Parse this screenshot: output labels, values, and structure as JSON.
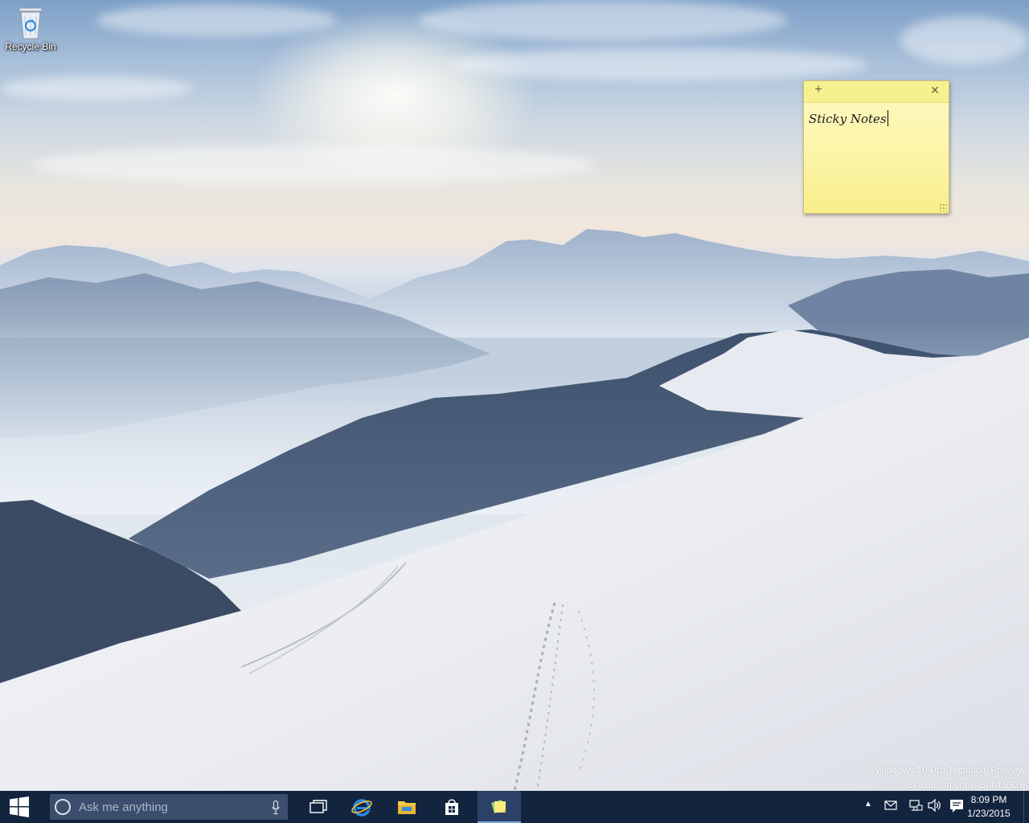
{
  "desktop": {
    "icons": [
      {
        "label": "Recycle Bin",
        "icon": "recycle-bin-icon"
      }
    ],
    "watermark": {
      "line1": "Windows 10 Pro Technical Preview",
      "line2": "Evaluation copy. Build 9926"
    }
  },
  "sticky_note": {
    "text": "Sticky Notes",
    "add_icon": "plus-icon",
    "close_icon": "close-icon",
    "color": "#fcf5a8"
  },
  "taskbar": {
    "color": "#13243f",
    "start_icon": "windows-logo-icon",
    "search": {
      "placeholder": "Ask me anything",
      "icon": "cortana-icon",
      "mic_icon": "microphone-icon"
    },
    "apps": [
      {
        "name": "task-view",
        "icon": "task-view-icon",
        "active": false
      },
      {
        "name": "internet-explorer",
        "icon": "internet-explorer-icon",
        "active": false
      },
      {
        "name": "file-explorer",
        "icon": "file-explorer-icon",
        "active": false
      },
      {
        "name": "store",
        "icon": "store-icon",
        "active": false
      },
      {
        "name": "sticky-notes",
        "icon": "sticky-notes-icon",
        "active": true
      }
    ],
    "tray": {
      "clock_time": "8:09 PM",
      "clock_date": "1/23/2015",
      "icons": [
        "show-hidden-icon",
        "network-icon",
        "volume-icon",
        "action-center-icon"
      ]
    }
  }
}
